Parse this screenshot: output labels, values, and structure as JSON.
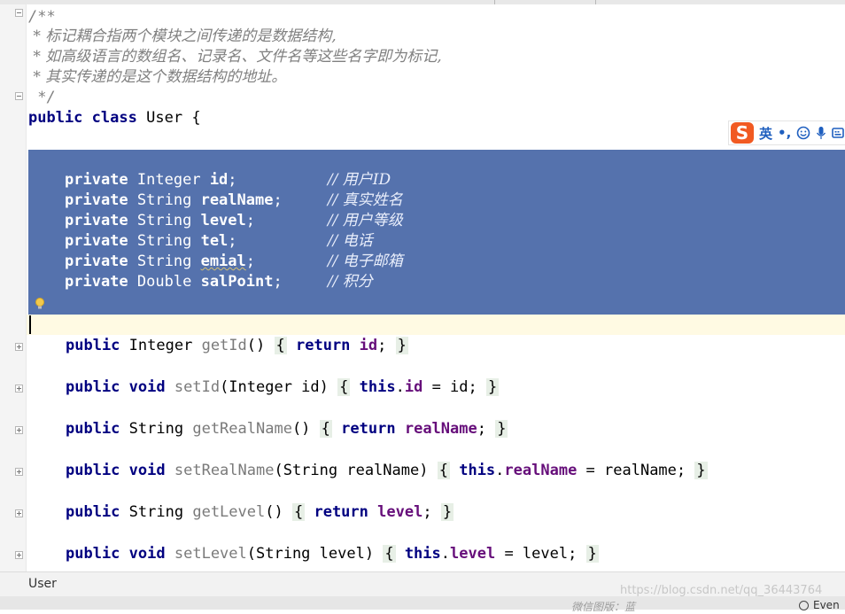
{
  "code": {
    "doc_comment": {
      "open": "/**",
      "lines": [
        " * 标记耦合指两个模块之间传递的是数据结构,",
        " * 如高级语言的数组名、记录名、文件名等这些名字即为标记,",
        " * 其实传递的是这个数据结构的地址。"
      ],
      "close": " */"
    },
    "class_decl": {
      "modifier": "public",
      "keyword": "class",
      "name": "User",
      "brace": "{"
    },
    "fields": [
      {
        "mod": "private",
        "type": "Integer",
        "name": "id",
        "comment": "// 用户ID"
      },
      {
        "mod": "private",
        "type": "String",
        "name": "realName",
        "comment": "// 真实姓名"
      },
      {
        "mod": "private",
        "type": "String",
        "name": "level",
        "comment": "// 用户等级"
      },
      {
        "mod": "private",
        "type": "String",
        "name": "tel",
        "comment": "// 电话"
      },
      {
        "mod": "private",
        "type": "String",
        "name": "emial",
        "comment": "// 电子邮箱"
      },
      {
        "mod": "private",
        "type": "Double",
        "name": "salPoint",
        "comment": "// 积分"
      }
    ],
    "methods": [
      {
        "mod": "public",
        "ret": "Integer",
        "name": "getId",
        "params": "()",
        "kw": "return",
        "this": "",
        "field": "id",
        "rest": ";"
      },
      {
        "mod": "public",
        "ret": "void",
        "name": "setId",
        "params": "(Integer id)",
        "kw": "this",
        "this": ".",
        "field": "id",
        "rest": " = id;"
      },
      {
        "mod": "public",
        "ret": "String",
        "name": "getRealName",
        "params": "()",
        "kw": "return",
        "this": "",
        "field": "realName",
        "rest": ";"
      },
      {
        "mod": "public",
        "ret": "void",
        "name": "setRealName",
        "params": "(String realName)",
        "kw": "this",
        "this": ".",
        "field": "realName",
        "rest": " = realName;"
      },
      {
        "mod": "public",
        "ret": "String",
        "name": "getLevel",
        "params": "()",
        "kw": "return",
        "this": "",
        "field": "level",
        "rest": ";"
      },
      {
        "mod": "public",
        "ret": "void",
        "name": "setLevel",
        "params": "(String level)",
        "kw": "this",
        "this": ".",
        "field": "level",
        "rest": " = level;"
      }
    ]
  },
  "ime_toolbar": {
    "logo": "S",
    "lang": "英",
    "punct": "•,",
    "icons": [
      "smiley-icon",
      "microphone-icon",
      "keyboard-icon"
    ]
  },
  "status_bar": {
    "breadcrumb": "User"
  },
  "watermark": {
    "url": "https://blog.csdn.net/qq_36443764",
    "author": "微信图版：蓝"
  },
  "event_log": {
    "label": "Even"
  },
  "colors": {
    "selection": "#5572ad",
    "keyword": "#000080",
    "field": "#660e7a",
    "comment": "#808080",
    "caret_line": "#fffae3"
  }
}
